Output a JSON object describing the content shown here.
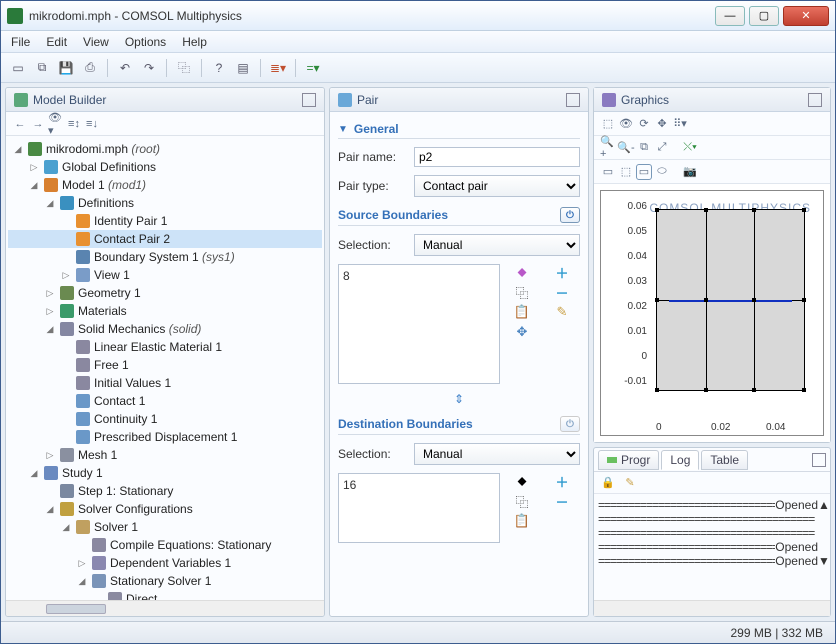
{
  "window": {
    "title": "mikrodomi.mph - COMSOL Multiphysics"
  },
  "menu": {
    "file": "File",
    "edit": "Edit",
    "view": "View",
    "options": "Options",
    "help": "Help"
  },
  "panels": {
    "model_builder": "Model Builder",
    "pair": "Pair",
    "graphics": "Graphics"
  },
  "tree": {
    "root": "mikrodomi.mph",
    "root_suffix": " (root)",
    "global": "Global Definitions",
    "model1": "Model 1",
    "model1_suffix": " (mod1)",
    "definitions": "Definitions",
    "identity_pair": "Identity Pair 1",
    "contact_pair": "Contact Pair 2",
    "boundary_system": "Boundary System 1",
    "boundary_system_suffix": " (sys1)",
    "view1": "View 1",
    "geometry": "Geometry 1",
    "materials": "Materials",
    "solid_mech": "Solid Mechanics",
    "solid_mech_suffix": " (solid)",
    "linear_elastic": "Linear Elastic Material 1",
    "free1": "Free 1",
    "initial_values": "Initial Values 1",
    "contact1": "Contact 1",
    "continuity1": "Continuity 1",
    "prescribed": "Prescribed Displacement 1",
    "mesh1": "Mesh 1",
    "study1": "Study 1",
    "step1": "Step 1: Stationary",
    "solver_configs": "Solver Configurations",
    "solver1": "Solver 1",
    "compile_eq": "Compile Equations: Stationary",
    "dependent_vars": "Dependent Variables 1",
    "stationary_solver": "Stationary Solver 1",
    "direct": "Direct"
  },
  "form": {
    "general": "General",
    "pair_name_label": "Pair name:",
    "pair_name_value": "p2",
    "pair_type_label": "Pair type:",
    "pair_type_value": "Contact pair",
    "source_boundaries": "Source Boundaries",
    "dest_boundaries": "Destination Boundaries",
    "selection_label": "Selection:",
    "selection_value": "Manual",
    "source_list": "8",
    "dest_list": "16"
  },
  "chart_data": {
    "type": "line",
    "title": "",
    "xlabel": "",
    "ylabel": "",
    "y_ticks": [
      "-0.01",
      "0",
      "0.01",
      "0.02",
      "0.03",
      "0.04",
      "0.05",
      "0.06"
    ],
    "x_ticks": [
      "0",
      "0.02",
      "0.04"
    ],
    "xlim": [
      -0.005,
      0.05
    ],
    "ylim": [
      -0.01,
      0.065
    ],
    "geometry": {
      "description": "Two adjacent rectangular domains stacked vertically with vertical subdivisions, contact pair highlighted along shared horizontal edge at y ≈ 0.03",
      "highlight_edge": {
        "y": 0.03,
        "x_range": [
          0.0,
          0.05
        ]
      }
    },
    "logo": "COMSOL MULTIPHYSICS"
  },
  "tabs": {
    "progr": "Progr",
    "log": "Log",
    "table": "Table"
  },
  "log": {
    "lines": [
      {
        "l": "=========",
        "r": "Opened"
      },
      {
        "l": "=========",
        "r": ""
      },
      {
        "l": "=========",
        "r": ""
      },
      {
        "l": "=========",
        "r": "Opened"
      },
      {
        "l": "=========",
        "r": "Opened"
      }
    ]
  },
  "status": {
    "memory": "299 MB | 332 MB"
  }
}
